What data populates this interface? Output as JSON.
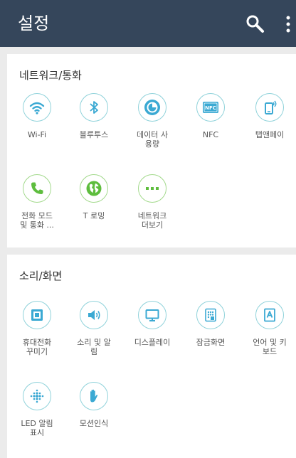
{
  "header": {
    "title": "설정",
    "search_icon": "search-icon",
    "menu_icon": "more-vert-icon"
  },
  "colors": {
    "appbar": "#35465b",
    "accent_blue": "#3ba9d3",
    "accent_green": "#5ebd3e"
  },
  "sections": [
    {
      "title": "네트워크/통화",
      "items": [
        {
          "label": "Wi-Fi",
          "icon": "wifi-icon"
        },
        {
          "label": "블루투스",
          "icon": "bluetooth-icon"
        },
        {
          "label": "데이터 사\n용량",
          "icon": "data-usage-icon"
        },
        {
          "label": "NFC",
          "icon": "nfc-icon"
        },
        {
          "label": "탭앤페이",
          "icon": "tap-pay-icon"
        },
        {
          "label": "전화 모드\n및 통화 ...",
          "icon": "phone-icon"
        },
        {
          "label": "T 로밍",
          "icon": "globe-icon"
        },
        {
          "label": "네트워크\n더보기",
          "icon": "more-dots-icon"
        }
      ]
    },
    {
      "title": "소리/화면",
      "items": [
        {
          "label": "휴대전화\n꾸미기",
          "icon": "theme-icon"
        },
        {
          "label": "소리 및 알\n림",
          "icon": "speaker-icon"
        },
        {
          "label": "디스플레이",
          "icon": "monitor-icon"
        },
        {
          "label": "잠금화면",
          "icon": "lock-screen-icon"
        },
        {
          "label": "언어 및 키\n보드",
          "icon": "language-icon"
        },
        {
          "label": "LED 알림\n표시",
          "icon": "led-icon"
        },
        {
          "label": "모션인식",
          "icon": "hand-motion-icon"
        }
      ]
    }
  ]
}
